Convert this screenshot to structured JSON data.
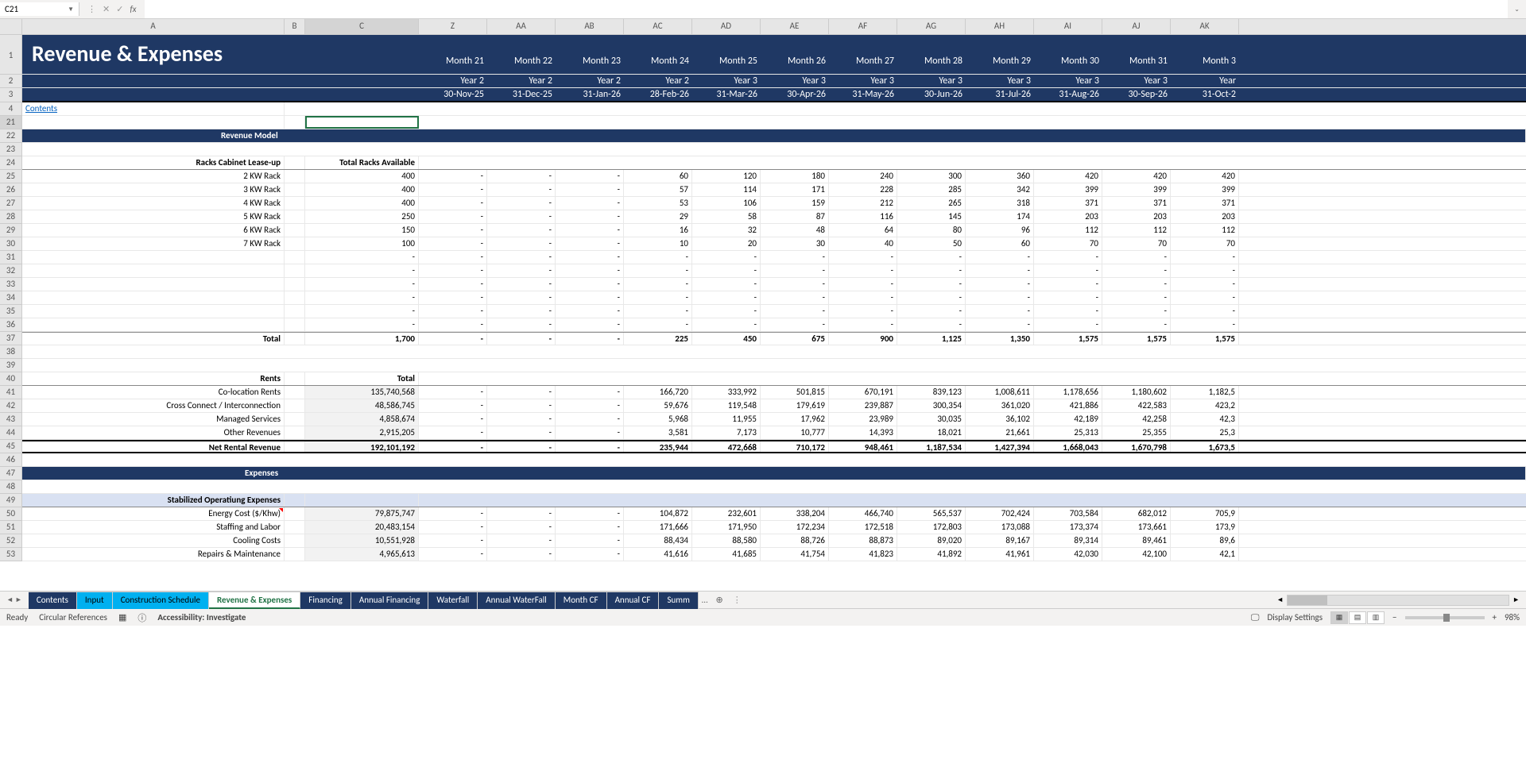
{
  "nameBox": "C21",
  "formulaInput": "",
  "title": "Revenue & Expenses",
  "contentsLink": "Contents",
  "colLetters": [
    "A",
    "B",
    "C",
    "Z",
    "AA",
    "AB",
    "AC",
    "AD",
    "AE",
    "AF",
    "AG",
    "AH",
    "AI",
    "AJ",
    "AK"
  ],
  "rowNumbers": [
    "1",
    "2",
    "3",
    "4",
    "21",
    "22",
    "23",
    "24",
    "25",
    "26",
    "27",
    "28",
    "29",
    "30",
    "31",
    "32",
    "33",
    "34",
    "35",
    "36",
    "37",
    "38",
    "39",
    "40",
    "41",
    "42",
    "43",
    "44",
    "45",
    "46",
    "47",
    "48",
    "49",
    "50",
    "51",
    "52",
    "53"
  ],
  "months": [
    "Month 21",
    "Month 22",
    "Month 23",
    "Month 24",
    "Month 25",
    "Month 26",
    "Month 27",
    "Month 28",
    "Month 29",
    "Month 30",
    "Month 31",
    "Month 3"
  ],
  "years": [
    "Year 2",
    "Year 2",
    "Year 2",
    "Year 2",
    "Year 3",
    "Year 3",
    "Year 3",
    "Year 3",
    "Year 3",
    "Year 3",
    "Year 3",
    "Year"
  ],
  "dates": [
    "30-Nov-25",
    "31-Dec-25",
    "31-Jan-26",
    "28-Feb-26",
    "31-Mar-26",
    "30-Apr-26",
    "31-May-26",
    "30-Jun-26",
    "31-Jul-26",
    "31-Aug-26",
    "30-Sep-26",
    "31-Oct-2"
  ],
  "sections": {
    "revenueModel": "Revenue Model",
    "expenses": "Expenses"
  },
  "racksHeader": {
    "label": "Racks Cabinet Lease-up",
    "col": "Total Racks Available"
  },
  "racks": [
    {
      "label": "2 KW Rack",
      "total": "400",
      "vals": [
        "-",
        "-",
        "-",
        "60",
        "120",
        "180",
        "240",
        "300",
        "360",
        "420",
        "420",
        "420"
      ]
    },
    {
      "label": "3 KW Rack",
      "total": "400",
      "vals": [
        "-",
        "-",
        "-",
        "57",
        "114",
        "171",
        "228",
        "285",
        "342",
        "399",
        "399",
        "399"
      ]
    },
    {
      "label": "4 KW Rack",
      "total": "400",
      "vals": [
        "-",
        "-",
        "-",
        "53",
        "106",
        "159",
        "212",
        "265",
        "318",
        "371",
        "371",
        "371"
      ]
    },
    {
      "label": "5 KW Rack",
      "total": "250",
      "vals": [
        "-",
        "-",
        "-",
        "29",
        "58",
        "87",
        "116",
        "145",
        "174",
        "203",
        "203",
        "203"
      ]
    },
    {
      "label": "6 KW Rack",
      "total": "150",
      "vals": [
        "-",
        "-",
        "-",
        "16",
        "32",
        "48",
        "64",
        "80",
        "96",
        "112",
        "112",
        "112"
      ]
    },
    {
      "label": "7 KW Rack",
      "total": "100",
      "vals": [
        "-",
        "-",
        "-",
        "10",
        "20",
        "30",
        "40",
        "50",
        "60",
        "70",
        "70",
        "70"
      ]
    }
  ],
  "emptyRacks": [
    {
      "label": "",
      "total": "-",
      "vals": [
        "-",
        "-",
        "-",
        "-",
        "-",
        "-",
        "-",
        "-",
        "-",
        "-",
        "-",
        "-"
      ]
    },
    {
      "label": "",
      "total": "-",
      "vals": [
        "-",
        "-",
        "-",
        "-",
        "-",
        "-",
        "-",
        "-",
        "-",
        "-",
        "-",
        "-"
      ]
    },
    {
      "label": "",
      "total": "-",
      "vals": [
        "-",
        "-",
        "-",
        "-",
        "-",
        "-",
        "-",
        "-",
        "-",
        "-",
        "-",
        "-"
      ]
    },
    {
      "label": "",
      "total": "-",
      "vals": [
        "-",
        "-",
        "-",
        "-",
        "-",
        "-",
        "-",
        "-",
        "-",
        "-",
        "-",
        "-"
      ]
    },
    {
      "label": "",
      "total": "-",
      "vals": [
        "-",
        "-",
        "-",
        "-",
        "-",
        "-",
        "-",
        "-",
        "-",
        "-",
        "-",
        "-"
      ]
    },
    {
      "label": "",
      "total": "-",
      "vals": [
        "-",
        "-",
        "-",
        "-",
        "-",
        "-",
        "-",
        "-",
        "-",
        "-",
        "-",
        "-"
      ]
    }
  ],
  "racksTotal": {
    "label": "Total",
    "total": "1,700",
    "vals": [
      "-",
      "-",
      "-",
      "225",
      "450",
      "675",
      "900",
      "1,125",
      "1,350",
      "1,575",
      "1,575",
      "1,575"
    ]
  },
  "rentsHeader": {
    "label": "Rents",
    "col": "Total"
  },
  "rents": [
    {
      "label": "Co-location Rents",
      "total": "135,740,568",
      "vals": [
        "-",
        "-",
        "-",
        "166,720",
        "333,992",
        "501,815",
        "670,191",
        "839,123",
        "1,008,611",
        "1,178,656",
        "1,180,602",
        "1,182,5"
      ]
    },
    {
      "label": "Cross Connect / Interconnection",
      "total": "48,586,745",
      "vals": [
        "-",
        "-",
        "-",
        "59,676",
        "119,548",
        "179,619",
        "239,887",
        "300,354",
        "361,020",
        "421,886",
        "422,583",
        "423,2"
      ]
    },
    {
      "label": "Managed Services",
      "total": "4,858,674",
      "vals": [
        "-",
        "-",
        "-",
        "5,968",
        "11,955",
        "17,962",
        "23,989",
        "30,035",
        "36,102",
        "42,189",
        "42,258",
        "42,3"
      ]
    },
    {
      "label": "Other Revenues",
      "total": "2,915,205",
      "vals": [
        "-",
        "-",
        "-",
        "3,581",
        "7,173",
        "10,777",
        "14,393",
        "18,021",
        "21,661",
        "25,313",
        "25,355",
        "25,3"
      ]
    }
  ],
  "netRental": {
    "label": "Net Rental Revenue",
    "total": "192,101,192",
    "vals": [
      "-",
      "-",
      "-",
      "235,944",
      "472,668",
      "710,172",
      "948,461",
      "1,187,534",
      "1,427,394",
      "1,668,043",
      "1,670,798",
      "1,673,5"
    ]
  },
  "opexHeader": "Stabilized Operatiung Expenses",
  "opex": [
    {
      "label": "Energy Cost ($/Khw)",
      "total": "79,875,747",
      "vals": [
        "-",
        "-",
        "-",
        "104,872",
        "232,601",
        "338,204",
        "466,740",
        "565,537",
        "702,424",
        "703,584",
        "682,012",
        "705,9"
      ],
      "red": true
    },
    {
      "label": "Staffing and Labor",
      "total": "20,483,154",
      "vals": [
        "-",
        "-",
        "-",
        "171,666",
        "171,950",
        "172,234",
        "172,518",
        "172,803",
        "173,088",
        "173,374",
        "173,661",
        "173,9"
      ]
    },
    {
      "label": "Cooling Costs",
      "total": "10,551,928",
      "vals": [
        "-",
        "-",
        "-",
        "88,434",
        "88,580",
        "88,726",
        "88,873",
        "89,020",
        "89,167",
        "89,314",
        "89,461",
        "89,6"
      ]
    },
    {
      "label": "Repairs & Maintenance",
      "total": "4,965,613",
      "vals": [
        "-",
        "-",
        "-",
        "41,616",
        "41,685",
        "41,754",
        "41,823",
        "41,892",
        "41,961",
        "42,030",
        "42,100",
        "42,1"
      ]
    }
  ],
  "tabs": [
    "Contents",
    "Input",
    "Construction Schedule",
    "Revenue & Expenses",
    "Financing",
    "Annual Financing",
    "Waterfall",
    "Annual WaterFall",
    "Month CF",
    "Annual CF",
    "Summ"
  ],
  "activeTab": "Revenue & Expenses",
  "status": {
    "ready": "Ready",
    "circular": "Circular References",
    "accessibility": "Accessibility: Investigate",
    "display": "Display Settings",
    "zoom": "98%"
  }
}
